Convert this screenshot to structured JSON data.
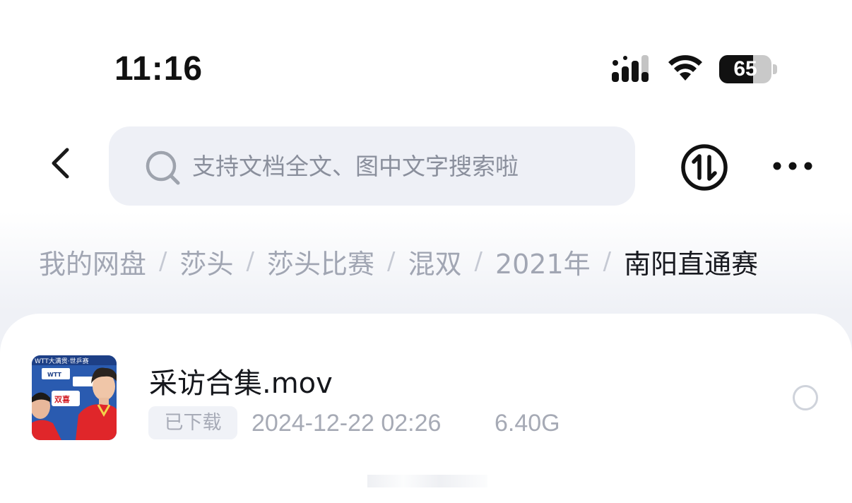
{
  "status_bar": {
    "time": "11:16",
    "battery": "65",
    "battery_level": 0.65,
    "icons": [
      "signal-icon",
      "wifi-icon",
      "battery-icon"
    ]
  },
  "toolbar": {
    "back_icon": "chevron-left-icon",
    "search_placeholder": "支持文档全文、图中文字搜索啦",
    "search_icon": "search-icon",
    "sort_icon": "sort-arrows-icon",
    "more_icon": "more-horizontal-icon"
  },
  "breadcrumb": {
    "separator": "/",
    "items": [
      "我的网盘",
      "莎头",
      "莎头比赛",
      "混双",
      "2021年",
      "南阳直通赛"
    ]
  },
  "files": [
    {
      "name": "采访合集.mov",
      "badge": "已下载",
      "date": "2024-12-22 02:26",
      "size": "6.40G",
      "thumbnail": "video-thumbnail",
      "thumbnail_texts": [
        "WTT大满贯·世乒赛",
        "WTT",
        "双喜"
      ]
    }
  ],
  "colors": {
    "accent_dark": "#17191f",
    "muted": "#a1a6b3",
    "search_bg": "#eef0f6",
    "jersey_red": "#e0262a"
  }
}
